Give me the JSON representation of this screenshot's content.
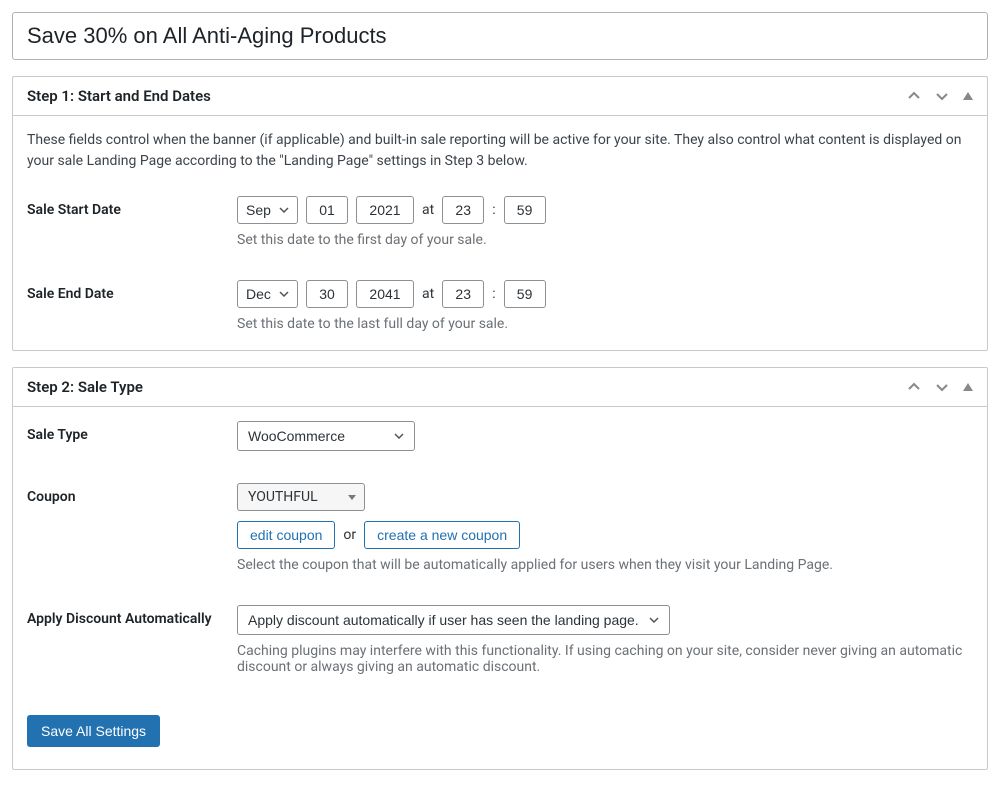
{
  "title": "Save 30% on All Anti-Aging Products",
  "step1": {
    "title": "Step 1: Start and End Dates",
    "desc": "These fields control when the banner (if applicable) and built-in sale reporting will be active for your site. They also control what content is displayed on your sale Landing Page according to the \"Landing Page\" settings in Step 3 below.",
    "start": {
      "label": "Sale Start Date",
      "month": "Sep",
      "day": "01",
      "year": "2021",
      "at": "at",
      "hour": "23",
      "colon": ":",
      "min": "59",
      "help": "Set this date to the first day of your sale."
    },
    "end": {
      "label": "Sale End Date",
      "month": "Dec",
      "day": "30",
      "year": "2041",
      "at": "at",
      "hour": "23",
      "colon": ":",
      "min": "59",
      "help": "Set this date to the last full day of your sale."
    }
  },
  "step2": {
    "title": "Step 2: Sale Type",
    "sale_type": {
      "label": "Sale Type",
      "value": "WooCommerce"
    },
    "coupon": {
      "label": "Coupon",
      "value": "YOUTHFUL",
      "edit": "edit coupon",
      "or": "or",
      "create": "create a new coupon",
      "help": "Select the coupon that will be automatically applied for users when they visit your Landing Page."
    },
    "apply": {
      "label": "Apply Discount Automatically",
      "value": "Apply discount automatically if user has seen the landing page.",
      "help": "Caching plugins may interfere with this functionality. If using caching on your site, consider never giving an automatic discount or always giving an automatic discount."
    }
  },
  "save_button": "Save All Settings"
}
